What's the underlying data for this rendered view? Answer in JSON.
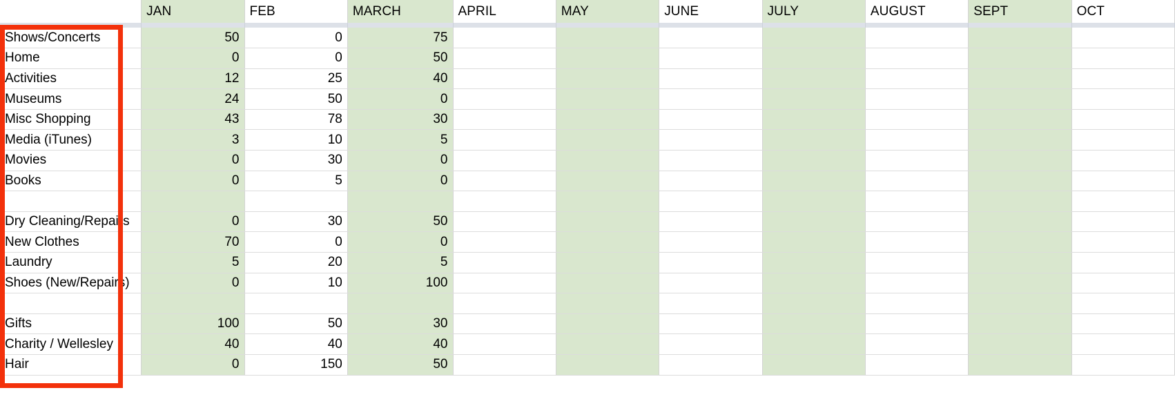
{
  "spreadsheet": {
    "row_header_column_title": "",
    "columns": [
      {
        "label": "",
        "tinted": false
      },
      {
        "label": "JAN",
        "tinted": true
      },
      {
        "label": "FEB",
        "tinted": false
      },
      {
        "label": "MARCH",
        "tinted": true
      },
      {
        "label": "APRIL",
        "tinted": false
      },
      {
        "label": "MAY",
        "tinted": true
      },
      {
        "label": "JUNE",
        "tinted": false
      },
      {
        "label": "JULY",
        "tinted": true
      },
      {
        "label": "AUGUST",
        "tinted": false
      },
      {
        "label": "SEPT",
        "tinted": true
      },
      {
        "label": "OCT",
        "tinted": false
      }
    ],
    "rows": [
      {
        "label": "Shows/Concerts",
        "jan": "50",
        "feb": "0",
        "march": "75",
        "spacer": false
      },
      {
        "label": "Home",
        "jan": "0",
        "feb": "0",
        "march": "50",
        "spacer": false
      },
      {
        "label": "Activities",
        "jan": "12",
        "feb": "25",
        "march": "40",
        "spacer": false
      },
      {
        "label": "Museums",
        "jan": "24",
        "feb": "50",
        "march": "0",
        "spacer": false
      },
      {
        "label": "Misc Shopping",
        "jan": "43",
        "feb": "78",
        "march": "30",
        "spacer": false
      },
      {
        "label": "Media (iTunes)",
        "jan": "3",
        "feb": "10",
        "march": "5",
        "spacer": false
      },
      {
        "label": "Movies",
        "jan": "0",
        "feb": "30",
        "march": "0",
        "spacer": false
      },
      {
        "label": "Books",
        "jan": "0",
        "feb": "5",
        "march": "0",
        "spacer": false
      },
      {
        "label": "",
        "jan": "",
        "feb": "",
        "march": "",
        "spacer": true
      },
      {
        "label": "Dry Cleaning/Repairs",
        "jan": "0",
        "feb": "30",
        "march": "50",
        "spacer": false
      },
      {
        "label": "New Clothes",
        "jan": "70",
        "feb": "0",
        "march": "0",
        "spacer": false
      },
      {
        "label": "Laundry",
        "jan": "5",
        "feb": "20",
        "march": "5",
        "spacer": false
      },
      {
        "label": "Shoes (New/Repairs)",
        "jan": "0",
        "feb": "10",
        "march": "100",
        "spacer": false
      },
      {
        "label": "",
        "jan": "",
        "feb": "",
        "march": "",
        "spacer": true
      },
      {
        "label": "Gifts",
        "jan": "100",
        "feb": "50",
        "march": "30",
        "spacer": false
      },
      {
        "label": "Charity / Wellesley",
        "jan": "40",
        "feb": "40",
        "march": "40",
        "spacer": false
      },
      {
        "label": "Hair",
        "jan": "0",
        "feb": "150",
        "march": "50",
        "spacer": false
      }
    ]
  },
  "annotation": {
    "highlight_color": "#f3310b",
    "target": "row-label-column"
  },
  "colors": {
    "tinted_column": "#d9e7ce",
    "grid_line": "#d4d4d4",
    "header_separator": "#dde1e8"
  }
}
